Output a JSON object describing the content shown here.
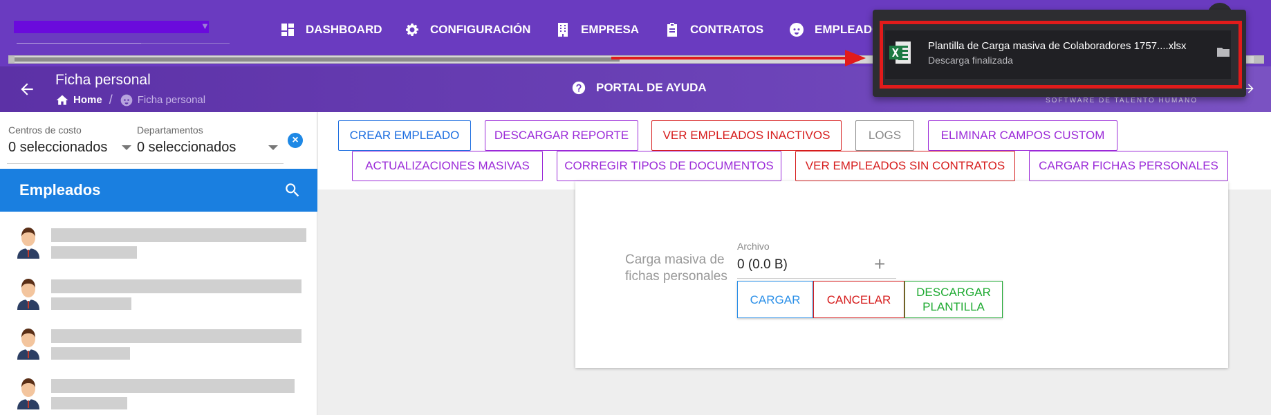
{
  "nav": {
    "items": [
      {
        "label": "DASHBOARD",
        "icon": "dashboard-icon"
      },
      {
        "label": "CONFIGURACIÓN",
        "icon": "gear-icon"
      },
      {
        "label": "EMPRESA",
        "icon": "building-icon"
      },
      {
        "label": "CONTRATOS",
        "icon": "clipboard-icon"
      },
      {
        "label": "EMPLEADOS",
        "icon": "face-icon"
      }
    ]
  },
  "subheader": {
    "title": "Ficha personal",
    "breadcrumb_home": "Home",
    "breadcrumb_current": "Ficha personal",
    "help_label": "PORTAL DE AYUDA",
    "tagline": "SOFTWARE DE TALENTO HUMANO"
  },
  "download": {
    "file_name": "Plantilla de Carga masiva de Colaboradores 1757....xlsx",
    "status": "Descarga finalizada"
  },
  "filters": {
    "cost_centers_label": "Centros de costo",
    "cost_centers_value": "0 seleccionados",
    "departments_label": "Departamentos",
    "departments_value": "0 seleccionados"
  },
  "employees": {
    "title": "Empleados"
  },
  "actions": {
    "crear_empleado": "CREAR EMPLEADO",
    "descargar_reporte": "DESCARGAR REPORTE",
    "ver_inactivos": "VER EMPLEADOS INACTIVOS",
    "logs": "LOGS",
    "eliminar_campos": "ELIMINAR CAMPOS CUSTOM",
    "actualizaciones": "ACTUALIZACIONES MASIVAS",
    "corregir_tipos": "CORREGIR TIPOS DE DOCUMENTOS",
    "ver_sin_contratos": "VER EMPLEADOS SIN CONTRATOS",
    "cargar_fichas": "CARGAR FICHAS PERSONALES"
  },
  "upload": {
    "label": "Carga masiva de fichas personales",
    "file_label": "Archivo",
    "file_value": "0 (0.0 B)",
    "cargar": "CARGAR",
    "cancelar": "CANCELAR",
    "descargar_plantilla": "DESCARGAR PLANTILLA"
  },
  "colors": {
    "topbar": "#6a3bc0",
    "accent_blue": "#1a7fe0",
    "purple": "#9b2ad8",
    "red": "#d61c1c",
    "green": "#1faa32"
  }
}
